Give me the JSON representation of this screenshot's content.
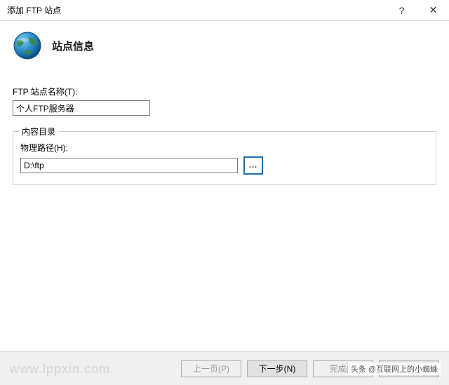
{
  "window": {
    "title": "添加 FTP 站点",
    "help": "?",
    "close": "✕"
  },
  "header": {
    "page_title": "站点信息"
  },
  "form": {
    "site_name_label": "FTP 站点名称(T):",
    "site_name_value": "个人FTP服务器",
    "content_dir_legend": "内容目录",
    "physical_path_label": "物理路径(H):",
    "physical_path_value": "D:\\ftp",
    "browse_label": "..."
  },
  "footer": {
    "prev": "上一页(P)",
    "next": "下一步(N)",
    "finish": "完成(F)",
    "cancel": "取消"
  },
  "watermark": "www.lppxin.com",
  "credit": "头条 @互联网上的小蜘蛛"
}
